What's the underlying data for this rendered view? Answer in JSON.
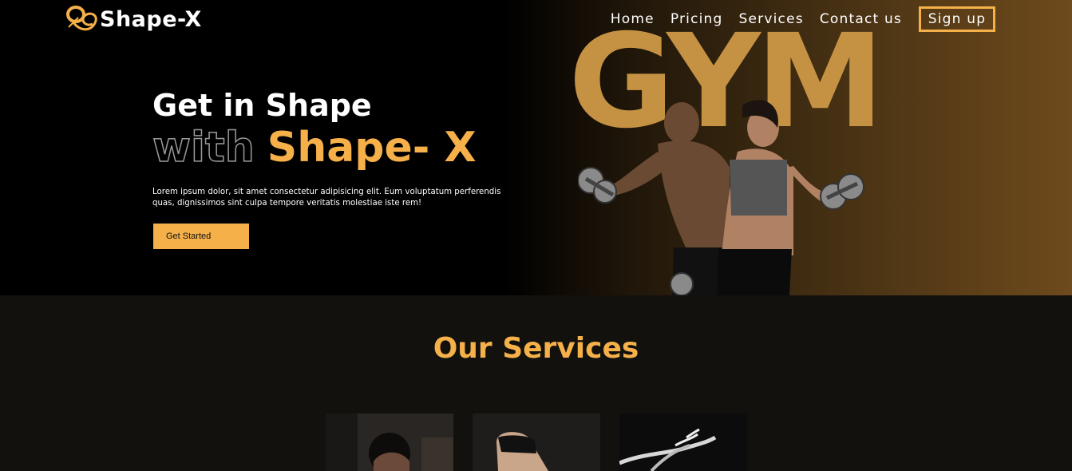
{
  "brand": {
    "name": "Shape-X",
    "logo_icon": "dumbbell-swirl-logo",
    "accent": "#f5b04a"
  },
  "nav": {
    "items": [
      {
        "label": "Home"
      },
      {
        "label": "Pricing"
      },
      {
        "label": "Services"
      },
      {
        "label": "Contact us"
      }
    ],
    "signup_label": "Sign up"
  },
  "hero": {
    "backdrop_word": "GYM",
    "headline_line1": "Get in Shape",
    "headline_outline": "with",
    "headline_accent": "Shape- X",
    "description": "Lorem ipsum dolor, sit amet consectetur adipisicing elit. Eum voluptatum perferendis quas, dignissimos sint culpa tempore veritatis molestiae iste rem!",
    "cta_label": "Get Started",
    "image": "couple-with-dumbbells-photo"
  },
  "services": {
    "title": "Our Services",
    "cards": [
      {
        "image": "woman-workout-photo"
      },
      {
        "image": "yoga-stretch-photo"
      },
      {
        "image": "dancer-photo"
      }
    ]
  }
}
